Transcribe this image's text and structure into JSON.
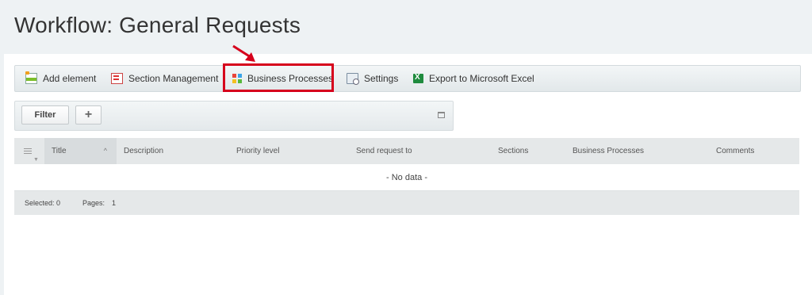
{
  "page": {
    "title": "Workflow: General Requests"
  },
  "toolbar": {
    "add_element": "Add element",
    "section_management": "Section Management",
    "business_processes": "Business Processes",
    "settings": "Settings",
    "export_excel": "Export to Microsoft Excel"
  },
  "filter": {
    "button_label": "Filter",
    "add_label": "+"
  },
  "grid": {
    "columns": [
      "Title",
      "Description",
      "Priority level",
      "Send request to",
      "Sections",
      "Business Processes",
      "Comments"
    ],
    "empty_text": "- No data -",
    "footer": {
      "selected": "Selected: 0",
      "pages_label": "Pages:",
      "pages_value": "1"
    }
  },
  "colors": {
    "highlight": "#d6001c",
    "background": "#eef2f4"
  }
}
